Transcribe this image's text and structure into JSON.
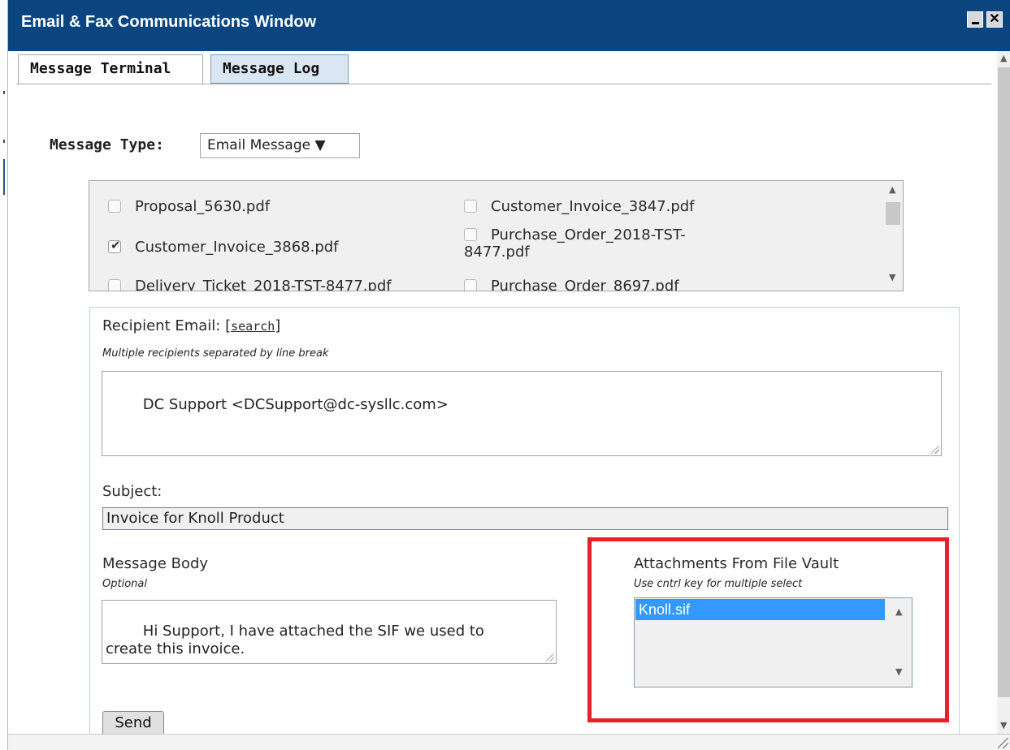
{
  "window": {
    "title": "Email & Fax Communications Window"
  },
  "tabs": [
    {
      "label": "Message Terminal",
      "active": true
    },
    {
      "label": "Message Log",
      "active": false
    }
  ],
  "message_type": {
    "label": "Message Type:",
    "value": "Email Message ▼"
  },
  "files": [
    {
      "name": "Proposal_5630.pdf",
      "checked": false
    },
    {
      "name": "Customer_Invoice_3847.pdf",
      "checked": false
    },
    {
      "name": "Customer_Invoice_3868.pdf",
      "checked": true
    },
    {
      "name": "Purchase_Order_2018-TST-",
      "name_cont": "8477.pdf",
      "checked": false
    },
    {
      "name": "Delivery_Ticket_2018-TST-8477.pdf",
      "checked": false
    },
    {
      "name": "Purchase_Order_8697.pdf",
      "checked": false
    }
  ],
  "recipient": {
    "label": "Recipient Email: [",
    "search_link": "search",
    "label_close": "]",
    "hint": "Multiple recipients separated by line break",
    "value": "DC Support <DCSupport@dc-sysllc.com>"
  },
  "subject": {
    "label": "Subject:",
    "value": "Invoice for Knoll Product"
  },
  "message_body": {
    "label": "Message Body",
    "hint": "Optional",
    "value": "Hi Support, I have attached the SIF we used to\ncreate this invoice."
  },
  "attachments": {
    "label": "Attachments From File Vault",
    "hint": "Use cntrl key for multiple select",
    "items": [
      "Knoll.sif"
    ],
    "selected": "Knoll.sif",
    "highlight_color": "#e8202a"
  },
  "send_label": "Send",
  "colors": {
    "titlebar": "#0a4580",
    "selection": "#3399ff"
  },
  "icons": {
    "minimize": "minimize-icon",
    "close": "close-icon"
  }
}
